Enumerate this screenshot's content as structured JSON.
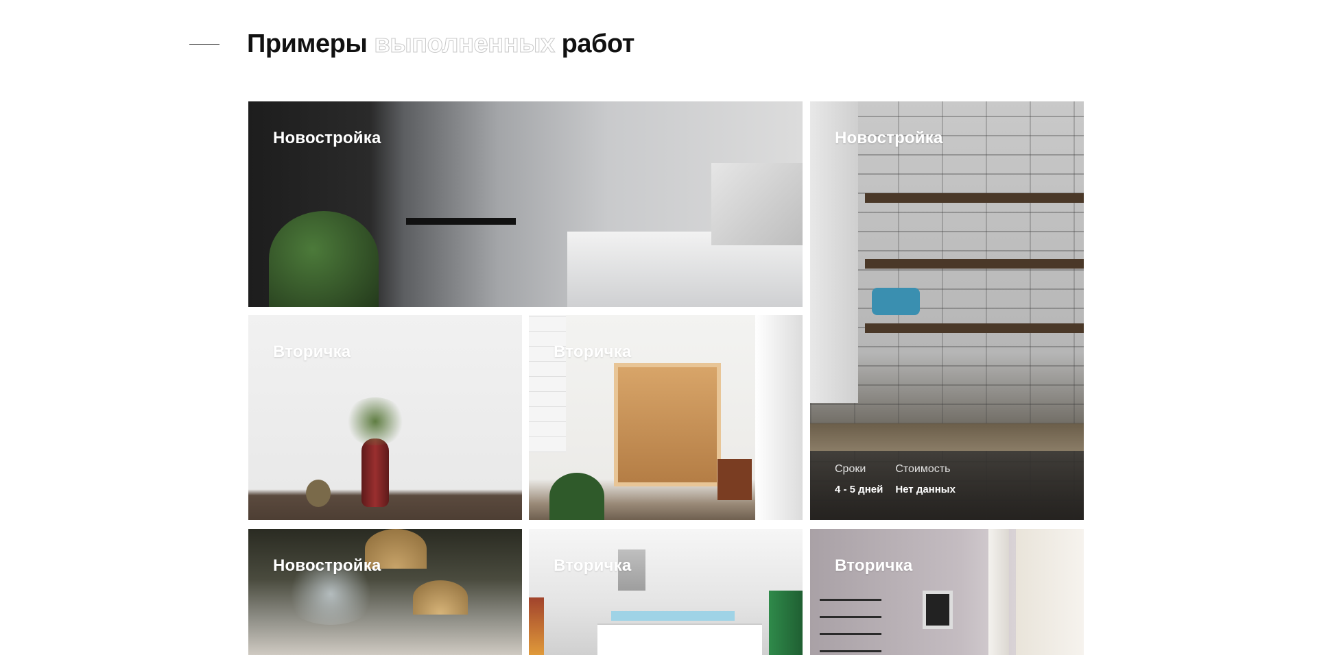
{
  "header": {
    "title_part1": "Примеры",
    "title_part2": "выполненных",
    "title_part3": "работ"
  },
  "gallery": {
    "items": [
      {
        "label": "Новостройка",
        "image": "kitchen-white-marble"
      },
      {
        "label": "Новостройка",
        "image": "kitchen-open-shelves",
        "details": {
          "term_label": "Сроки",
          "term_value": "4 - 5 дней",
          "price_label": "Стоимость",
          "price_value": "Нет данных"
        }
      },
      {
        "label": "Вторичка",
        "image": "vase-with-flowers"
      },
      {
        "label": "Вторичка",
        "image": "wooden-panel-room"
      },
      {
        "label": "Новостройка",
        "image": "wicker-lamps-brick"
      },
      {
        "label": "Вторичка",
        "image": "modern-white-kitchen"
      },
      {
        "label": "Вторичка",
        "image": "living-room-shelves"
      }
    ]
  },
  "colors": {
    "background": "#ffffff",
    "text": "#111111",
    "label": "#ffffff"
  }
}
